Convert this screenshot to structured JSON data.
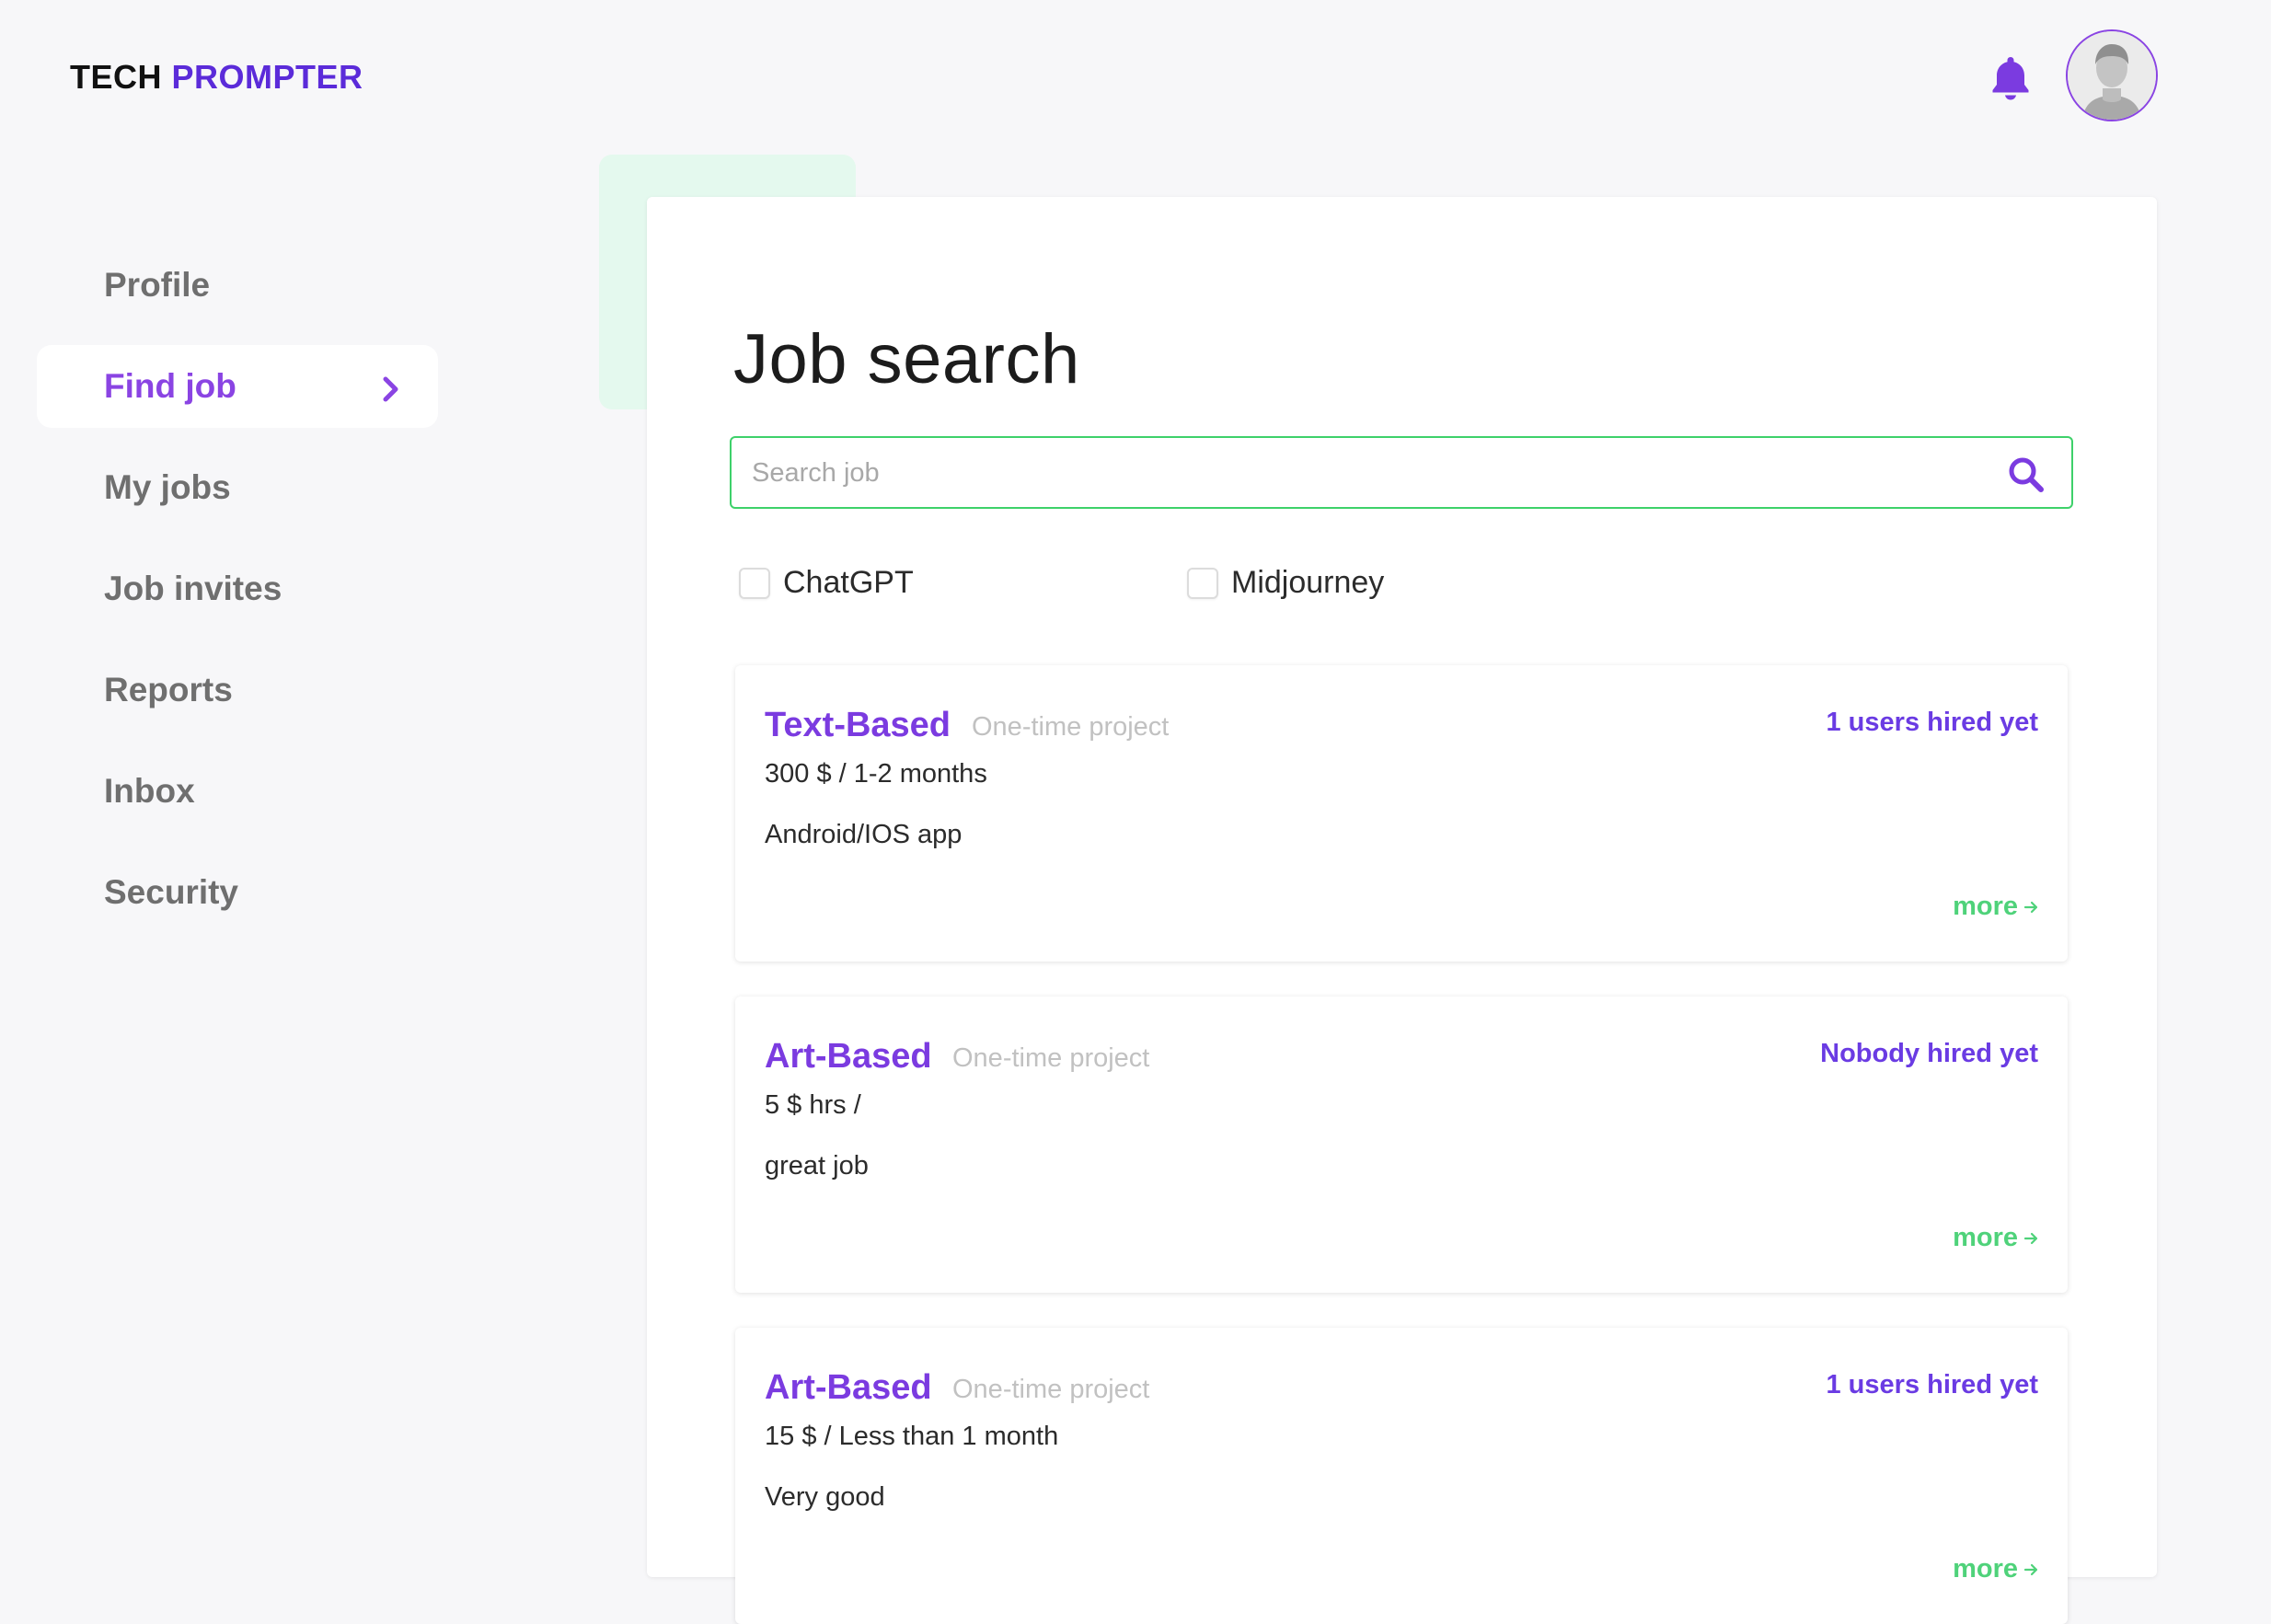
{
  "brand": {
    "part1": "TECH",
    "part2": "PROMPTER"
  },
  "header": {
    "icons": [
      "bell-icon",
      "avatar"
    ]
  },
  "sidebar": {
    "items": [
      {
        "label": "Profile",
        "active": false
      },
      {
        "label": "Find job",
        "active": true
      },
      {
        "label": "My jobs",
        "active": false
      },
      {
        "label": "Job invites",
        "active": false
      },
      {
        "label": "Reports",
        "active": false
      },
      {
        "label": "Inbox",
        "active": false
      },
      {
        "label": "Security",
        "active": false
      }
    ]
  },
  "main": {
    "title": "Job search",
    "search": {
      "placeholder": "Search job",
      "value": ""
    },
    "filters": [
      {
        "label": "ChatGPT",
        "checked": false
      },
      {
        "label": "Midjourney",
        "checked": false
      }
    ],
    "jobs": [
      {
        "title": "Text-Based",
        "type": "One-time project",
        "hired": "1 users hired yet",
        "rate": "300 $ / 1-2 months",
        "description": "Android/IOS app",
        "more": "more"
      },
      {
        "title": "Art-Based",
        "type": "One-time project",
        "hired": "Nobody hired yet",
        "rate": "5 $ hrs /",
        "description": "great job",
        "more": "more"
      },
      {
        "title": "Art-Based",
        "type": "One-time project",
        "hired": "1 users hired yet",
        "rate": "15 $ / Less than 1 month",
        "description": "Very good",
        "more": "more"
      }
    ]
  },
  "colors": {
    "brand_purple": "#5b2bd9",
    "accent_purple": "#8a44e3",
    "accent_green": "#3ed16a",
    "background": "#f7f7f9"
  }
}
